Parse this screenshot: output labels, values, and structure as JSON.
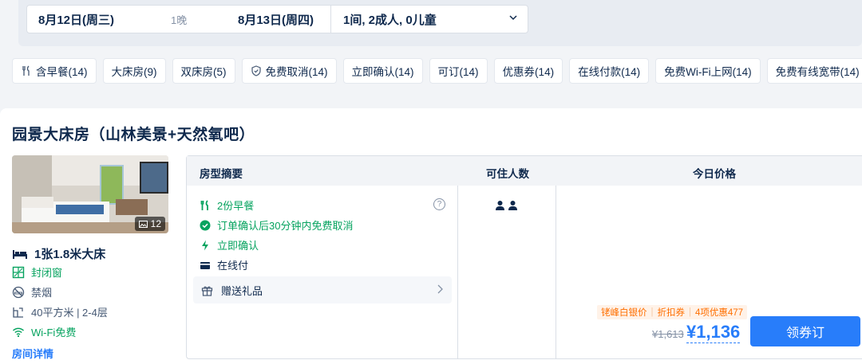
{
  "search": {
    "checkin": "8月12日(周三)",
    "nights": "1晚",
    "checkout": "8月13日(周四)",
    "guests": "1间, 2成人, 0儿童"
  },
  "filters": [
    {
      "label": "含早餐(14)",
      "icon": "utensils-icon"
    },
    {
      "label": "大床房(9)",
      "icon": ""
    },
    {
      "label": "双床房(5)",
      "icon": ""
    },
    {
      "label": "免费取消(14)",
      "icon": "shield-icon"
    },
    {
      "label": "立即确认(14)",
      "icon": ""
    },
    {
      "label": "可订(14)",
      "icon": ""
    },
    {
      "label": "优惠券(14)",
      "icon": ""
    },
    {
      "label": "在线付款(14)",
      "icon": ""
    },
    {
      "label": "免费Wi-Fi上网(14)",
      "icon": ""
    },
    {
      "label": "免费有线宽带(14)",
      "icon": ""
    }
  ],
  "room": {
    "title": "园景大床房（山林美景+天然氧吧）",
    "photo_count": "12",
    "bed": "1张1.8米大床",
    "window": "封闭窗",
    "smoking": "禁烟",
    "area_floor": "40平方米 | 2-4层",
    "wifi": "Wi-Fi免费",
    "detail_link": "房间详情"
  },
  "table": {
    "headers": {
      "summary": "房型摘要",
      "occupancy": "可住人数",
      "price": "今日价格"
    },
    "policies": {
      "breakfast": "2份早餐",
      "cancel": "订单确认后30分钟内免费取消",
      "confirm": "立即确认",
      "payment": "在线付"
    },
    "gift": "赠送礼品",
    "promo": {
      "tag1": "铑峰白银价",
      "tag2": "折扣券",
      "tag3": "4项优惠477"
    },
    "price_old": "¥1,613",
    "price_new": "¥1,136",
    "book_label": "领券订"
  },
  "colors": {
    "brand_blue": "#287dfa",
    "green": "#06a35f",
    "orange": "#ff6f00"
  }
}
